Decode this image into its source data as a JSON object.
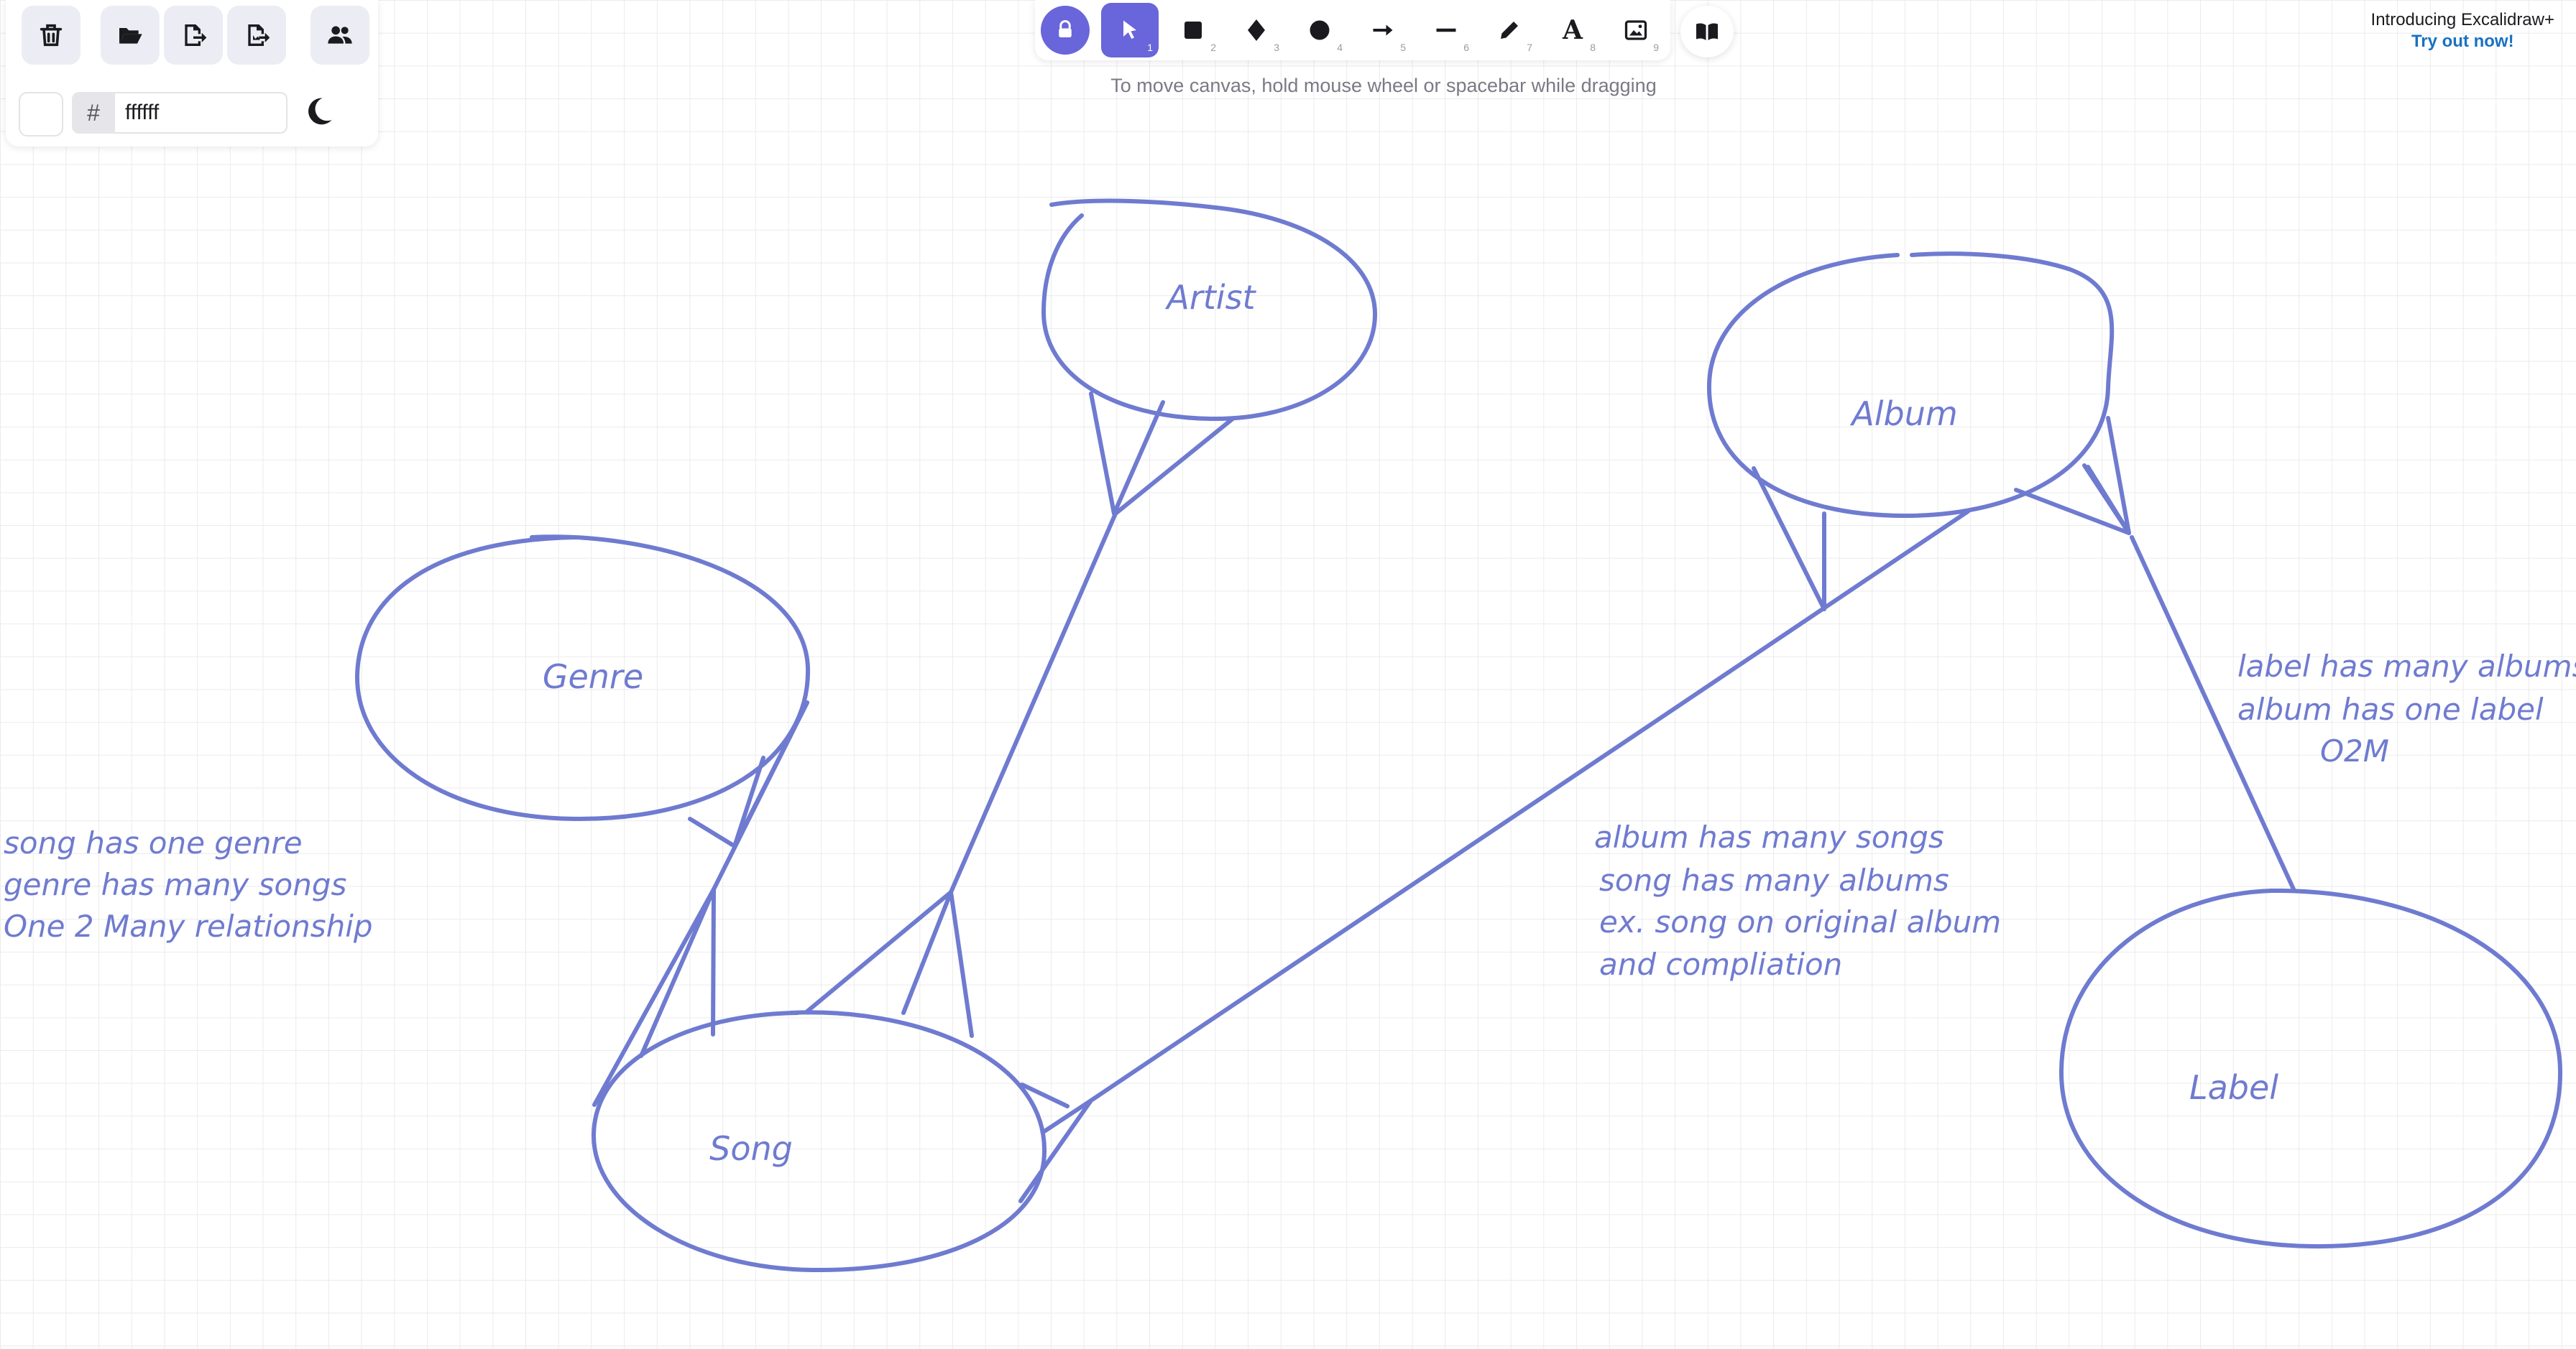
{
  "canvas": {
    "background_color": "#ffffff",
    "stroke_color": "#6f7bd0",
    "shapes": {
      "artist": {
        "label": "Artist"
      },
      "album": {
        "label": "Album"
      },
      "genre": {
        "label": "Genre"
      },
      "song": {
        "label": "Song"
      },
      "label": {
        "label": "Label"
      }
    },
    "notes": {
      "genre_song": [
        "song has one genre",
        "genre has many songs",
        "One 2 Many relationship"
      ],
      "album_song": [
        "album has many songs",
        "song has many albums",
        "ex. song on original album",
        "and compliation"
      ],
      "label_album": [
        "label has many albums",
        "album has one label",
        "O2M"
      ]
    }
  },
  "left_panel": {
    "buttons": [
      {
        "name": "clear-canvas",
        "icon": "trash-icon"
      },
      {
        "name": "open",
        "icon": "folder-open-icon"
      },
      {
        "name": "save-to",
        "icon": "file-export-icon"
      },
      {
        "name": "export-image",
        "icon": "image-export-icon"
      },
      {
        "name": "live-collaboration",
        "icon": "users-icon"
      }
    ],
    "hash": "#",
    "background_hex": "ffffff",
    "theme_icon": "moon-icon"
  },
  "toolbar": {
    "accent": "#6965db",
    "tools": [
      {
        "name": "selection",
        "icon": "cursor-icon",
        "key": "1",
        "active": true
      },
      {
        "name": "rectangle",
        "icon": "square-icon",
        "key": "2"
      },
      {
        "name": "diamond",
        "icon": "diamond-icon",
        "key": "3"
      },
      {
        "name": "ellipse",
        "icon": "circle-icon",
        "key": "4"
      },
      {
        "name": "arrow",
        "icon": "arrow-icon",
        "key": "5"
      },
      {
        "name": "line",
        "icon": "line-icon",
        "key": "6"
      },
      {
        "name": "draw",
        "icon": "pencil-icon",
        "key": "7"
      },
      {
        "name": "text",
        "icon": "text-icon",
        "key": "8",
        "glyph": "A"
      },
      {
        "name": "image",
        "icon": "image-icon",
        "key": "9"
      }
    ],
    "hint": "To move canvas, hold mouse wheel or spacebar while dragging"
  },
  "promo": {
    "title": "Introducing Excalidraw+",
    "link": "Try out now!"
  }
}
